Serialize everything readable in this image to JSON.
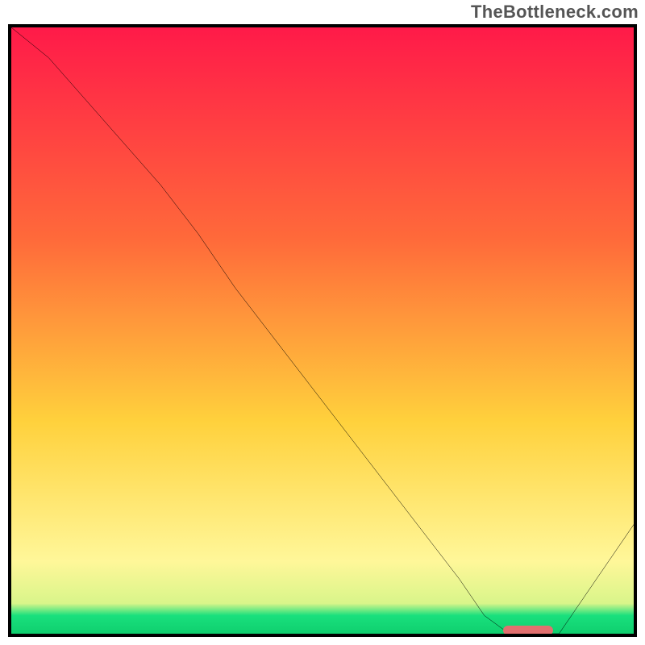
{
  "watermark": "TheBottleneck.com",
  "chart_data": {
    "type": "line",
    "title": "",
    "xlabel": "",
    "ylabel": "",
    "xlim": [
      0,
      100
    ],
    "ylim": [
      0,
      100
    ],
    "grid": false,
    "x": [
      0,
      6,
      12,
      18,
      24,
      30,
      36,
      42,
      48,
      54,
      60,
      66,
      72,
      76,
      80,
      84,
      88,
      92,
      96,
      100
    ],
    "values": [
      102,
      95,
      88,
      81,
      74,
      66,
      57,
      49,
      41,
      33,
      25,
      17,
      9,
      3,
      0,
      0,
      0,
      6,
      12,
      18
    ],
    "optimal_region": {
      "start": 79,
      "end": 87,
      "y": 0
    },
    "gradient_colors": {
      "top": "#ff1a49",
      "mid1": "#ff6a3a",
      "mid2": "#ffd13c",
      "low": "#fff799",
      "bottom_band": "#19e07d"
    }
  }
}
